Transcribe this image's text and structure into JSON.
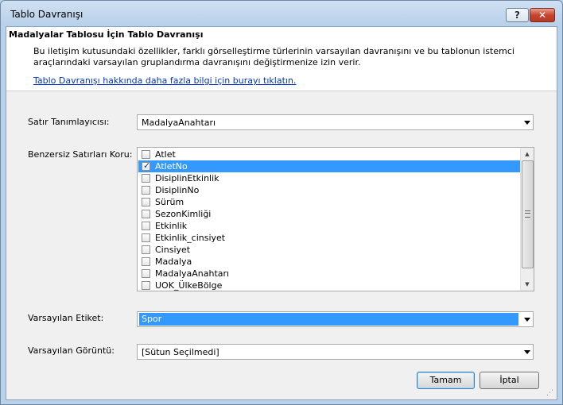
{
  "window": {
    "title": "Tablo Davranışı",
    "help_label": "?",
    "close_label": "✕"
  },
  "header": {
    "title": "Madalyalar Tablosu İçin Tablo Davranışı",
    "description": "Bu iletişim kutusundaki özellikler, farklı görselleştirme türlerinin varsayılan davranışını ve bu tablonun istemci araçlarındaki varsayılan gruplandırma davranışını değiştirmenize izin verir.",
    "link": "Tablo Davranışı hakkında daha fazla bilgi için burayı tıklatın."
  },
  "row_identifier": {
    "label": "Satır Tanımlayıcısı:",
    "value": "MadalyaAnahtarı"
  },
  "keep_unique_rows": {
    "label": "Benzersiz Satırları Koru:",
    "items": [
      {
        "label": "Atlet",
        "checked": false,
        "selected": false
      },
      {
        "label": "AtletNo",
        "checked": true,
        "selected": true
      },
      {
        "label": "DisiplinEtkinlik",
        "checked": false,
        "selected": false
      },
      {
        "label": "DisiplinNo",
        "checked": false,
        "selected": false
      },
      {
        "label": "Sürüm",
        "checked": false,
        "selected": false
      },
      {
        "label": "SezonKimliği",
        "checked": false,
        "selected": false
      },
      {
        "label": "Etkinlik",
        "checked": false,
        "selected": false
      },
      {
        "label": "Etkinlik_cinsiyet",
        "checked": false,
        "selected": false
      },
      {
        "label": "Cinsiyet",
        "checked": false,
        "selected": false
      },
      {
        "label": "Madalya",
        "checked": false,
        "selected": false
      },
      {
        "label": "MadalyaAnahtarı",
        "checked": false,
        "selected": false
      },
      {
        "label": "UOK_ÜlkeBölge",
        "checked": false,
        "selected": false
      }
    ]
  },
  "default_label": {
    "label": "Varsayılan Etiket:",
    "value": "Spor"
  },
  "default_image": {
    "label": "Varsayılan Görüntü:",
    "value": "[Sütun Seçilmedi]"
  },
  "buttons": {
    "ok": "Tamam",
    "cancel": "İptal"
  },
  "colors": {
    "selection": "#3399ff",
    "link": "#0033cc"
  }
}
